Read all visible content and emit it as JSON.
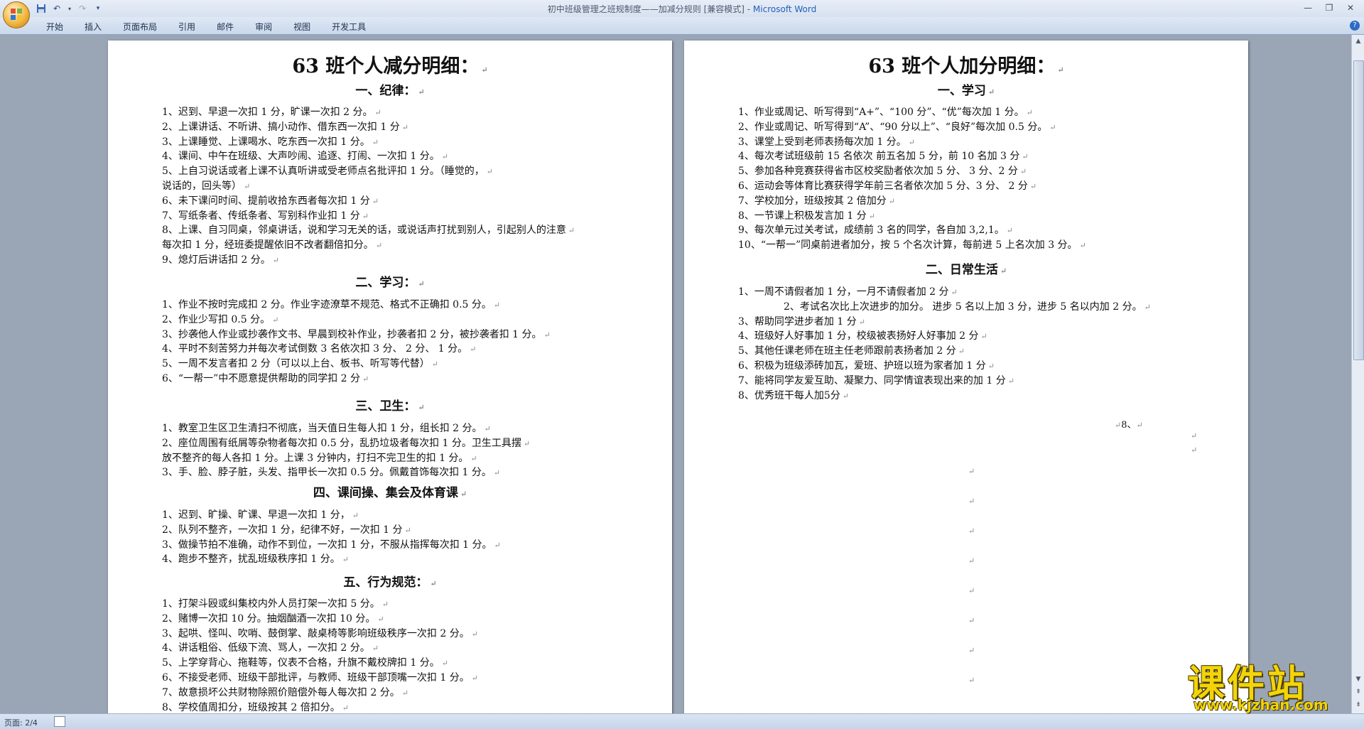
{
  "window": {
    "title": "初中班级管理之班规制度——加减分规则 [兼容模式] - ",
    "app_name": "Microsoft Word",
    "qat": {
      "save": "save-icon",
      "undo": "undo-icon",
      "redo": "redo-icon",
      "customize": "▾"
    }
  },
  "ribbon": {
    "tabs": [
      "开始",
      "插入",
      "页面布局",
      "引用",
      "邮件",
      "审阅",
      "视图",
      "开发工具"
    ],
    "help": "?"
  },
  "left_page": {
    "title": "63 班个人减分明细：",
    "sections": [
      {
        "heading": "一、纪律：",
        "lines": [
          "1、迟到、早退一次扣   1 分，旷课一次扣 2 分。",
          "2、上课讲话、不听讲、搞小动作、借东西一次扣 1 分",
          "3、上课睡觉、上课喝水、吃东西一次扣 1 分。",
          "4、课间、中午在班级、大声吵闹、追逐、打闹、一次扣 1 分。",
          "5、上自习说话或者上课不认真听讲或受老师点名批评扣 1 分。（睡觉的，",
          "说话的，回头等）",
          "6、未下课问时间、提前收拾东西者每次扣 1 分",
          "7、写纸条者、传纸条者、写别科作业扣 1 分",
          "8、上课、自习同桌，邻桌讲话，说和学习无关的话，或说话声打扰到别人，引起别人的注意",
          "每次扣    1 分，经班委提醒依旧不改者翻倍扣分。",
          "9、熄灯后讲话扣 2 分。"
        ]
      },
      {
        "heading": "二、学习：",
        "lines": [
          "1、作业不按时完成扣 2 分。作业字迹潦草不规范、格式不正确扣 0.5 分。",
          "2、作业少写扣 0.5 分。",
          "3、抄袭他人作业或抄袭作文书、早晨到校补作业，抄袭者扣 2 分，被抄袭者扣 1 分。",
          "4、平时不刻苦努力并每次考试倒数 3 名依次扣 3 分、  2 分、   1 分。",
          "5、一周不发言者扣 2 分（可以以上台、板书、听写等代替）",
          "6、“一帮一”中不愿意提供帮助的同学扣 2 分"
        ]
      },
      {
        "heading": "三、卫生：",
        "lines": [
          "1、教室卫生区卫生清扫不彻底，当天值日生每人扣 1 分，组长扣 2 分。",
          "2、座位周围有纸屑等杂物者每次扣 0.5 分，乱扔垃圾者每次扣 1 分。卫生工具摆",
          "放不整齐的每人各扣 1 分。上课 3 分钟内，打扫不完卫生的扣 1 分。",
          "3、手、脸、脖子脏，头发、指甲长一次扣 0.5 分。佩戴首饰每次扣 1 分。"
        ]
      },
      {
        "heading": "四、课间操、集会及体育课",
        "lines": [
          "1、迟到、旷操、旷课、早退一次扣 1 分，",
          "2、队列不整齐，一次扣 1 分，纪律不好，一次扣 1 分",
          "3、做操节拍不准确，动作不到位，一次扣 1 分，不服从指挥每次扣 1 分。",
          "4、跑步不整齐，扰乱班级秩序扣 1 分。"
        ]
      },
      {
        "heading": "五、行为规范：",
        "lines": [
          "1、打架斗殴或纠集校内外人员打架一次扣 5   分。",
          "2、赌博一次扣 10 分。抽烟酗酒一次扣 10  分。",
          "3、起哄、怪叫、吹哨、鼓倒掌、敲桌椅等影响班级秩序一次扣 2 分。",
          "4、讲话粗俗、低级下流、骂人，一次扣 2 分。",
          "5、上学穿背心、拖鞋等，仪表不合格，升旗不戴校牌扣 1 分。",
          "6、不接受老师、班级干部批评，与教师、班级干部顶嘴一次扣 1 分。",
          "7、故意损坏公共财物除照价赔偿外每人每次扣   2 分。",
          "8、学校值周扣分，班级按其 2 倍扣分。"
        ]
      }
    ]
  },
  "right_page": {
    "title": "63 班个人加分明细：",
    "sections": [
      {
        "heading": "一、学习",
        "lines": [
          "1、作业或周记、听写得到“A+”、“100 分”、“优”每次加 1 分。",
          "2、作业或周记、听写得到“A”、“90 分以上”、“良好”每次加 0.5 分。",
          "3、课堂上受到老师表扬每次加 1 分。",
          "4、每次考试班级前 15 名依次 前五名加 5 分，前 10 名加 3 分",
          "5、参加各种竞赛获得省市区校奖励者依次加 5  分、 3 分、2  分",
          "6、运动会等体育比赛获得学年前三名者依次加 5 分、3  分、 2 分",
          "7、学校加分，班级按其 2 倍加分",
          "8、一节课上积极发言加 1 分",
          "9、每次单元过关考试，成绩前 3 名的同学，各自加 3,2,1。",
          "10、“一帮一”同桌前进者加分，按 5 个名次计算，每前进 5 上名次加 3 分。"
        ]
      },
      {
        "heading": "二、日常生活",
        "lines": [
          "1、一周不请假者加 1  分，一月不请假者加 2 分",
          "2、考试名次比上次进步的加分。    进步 5 名以上加 3 分，进步 5 名以内加 2 分。",
          "3、帮助同学进步者加   1 分",
          "4、班级好人好事加   1 分，校级被表扬好人好事加 2 分",
          "5、其他任课老师在班主任老师跟前表扬者加   2  分",
          "6、积极为班级添砖加瓦，爱班、护班以班为家者加   1 分",
          "7、能将同学友爱互助、凝聚力、同学情谊表现出来的加 1 分",
          "8、优秀班干每人加5分"
        ]
      }
    ],
    "stray_text": "8、"
  },
  "marks": {
    "paragraph": "↵"
  },
  "statusbar": {
    "page_info": "页面: 2/4"
  },
  "watermark": {
    "name": "课件站",
    "url": "www.kjzhan.com",
    "color": "#f2d40a"
  }
}
